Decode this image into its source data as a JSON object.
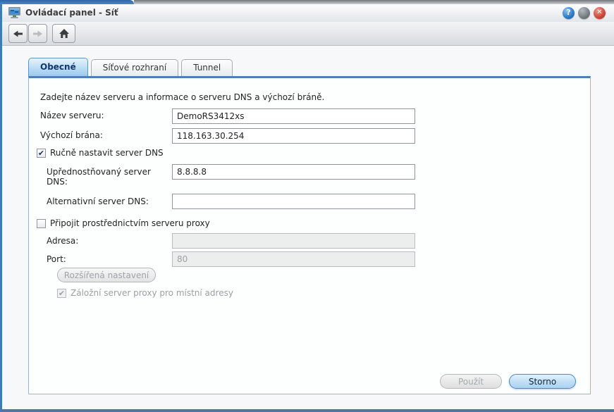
{
  "window": {
    "title": "Ovládací panel - Síť"
  },
  "window_controls": {
    "help_icon": "question-mark",
    "help_glyph": "?",
    "minimize_icon": "minimize-sphere",
    "close_icon": "close-x",
    "close_glyph": "✕"
  },
  "toolbar": {
    "back_icon": "arrow-left",
    "forward_icon": "arrow-right",
    "home_icon": "house"
  },
  "tabs": [
    {
      "label": "Obecné",
      "active": true
    },
    {
      "label": "Síťové rozhraní",
      "active": false
    },
    {
      "label": "Tunnel",
      "active": false
    }
  ],
  "form": {
    "description": "Zadejte název serveru a informace o serveru DNS a výchozí bráně.",
    "server_name": {
      "label": "Název serveru:",
      "value": "DemoRS3412xs"
    },
    "gateway": {
      "label": "Výchozí brána:",
      "value": "118.163.30.254"
    },
    "manual_dns": {
      "label": "Ručně nastavit server DNS",
      "checked": true
    },
    "dns_preferred": {
      "label": "Upřednostňovaný server DNS:",
      "value": "8.8.8.8"
    },
    "dns_alternative": {
      "label": "Alternativní server DNS:",
      "value": ""
    },
    "proxy": {
      "label": "Připojit prostřednictvím serveru proxy",
      "checked": false
    },
    "proxy_address": {
      "label": "Adresa:",
      "value": "",
      "disabled": true
    },
    "proxy_port": {
      "label": "Port:",
      "value": "80",
      "disabled": true
    },
    "advanced_button_label": "Rozšířená nastavení",
    "proxy_backup": {
      "label": "Záložní server proxy pro místní adresy",
      "checked": true,
      "disabled": true
    }
  },
  "footer": {
    "apply_label": "Použít",
    "cancel_label": "Storno"
  },
  "icons": {
    "check_glyph": "✔"
  },
  "colors": {
    "window_border": "#3f7cb6",
    "accent_blue": "#4e80b6",
    "tab_active_text": "#10386b",
    "help_blue": "#2a77c6",
    "close_red": "#cc4437"
  }
}
